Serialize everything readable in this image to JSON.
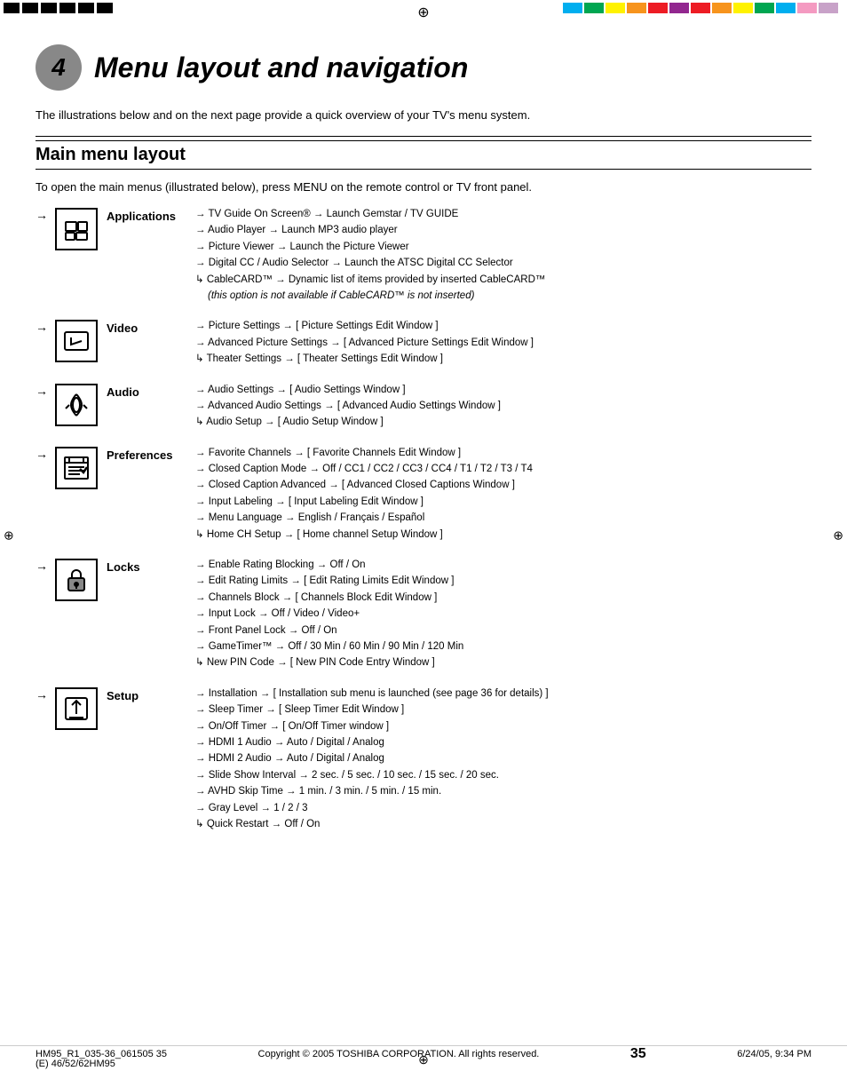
{
  "page": {
    "number": "35",
    "copyright": "Copyright © 2005 TOSHIBA CORPORATION. All rights reserved.",
    "footer_left": "HM95_R1_035-36_061505        35",
    "footer_right": "6/24/05, 9:34 PM",
    "bottom_model": "(E) 46/52/62HM95"
  },
  "chapter": {
    "number": "4",
    "title": "Menu layout and navigation"
  },
  "intro": "The illustrations below and on the next page provide a quick overview of your TV's menu system.",
  "section_title": "Main menu layout",
  "section_subtitle": "To open the main menus (illustrated below), press MENU on the remote control or TV front panel.",
  "menu_sections": [
    {
      "id": "applications",
      "label": "Applications",
      "items": [
        "TV Guide On Screen® → Launch Gemstar / TV GUIDE",
        "Audio Player → Launch MP3 audio player",
        "Picture Viewer → Launch the Picture Viewer",
        "Digital CC / Audio Selector → Launch the ATSC Digital CC Selector",
        "CableCARD™ → Dynamic list of items provided by inserted CableCARD™",
        "(this option is not available if CableCARD™ is not inserted)"
      ],
      "italic_index": 5
    },
    {
      "id": "video",
      "label": "Video",
      "items": [
        "Picture Settings → [ Picture Settings Edit Window ]",
        "Advanced Picture Settings → [ Advanced Picture Settings Edit Window ]",
        "Theater Settings → [ Theater Settings Edit Window ]"
      ]
    },
    {
      "id": "audio",
      "label": "Audio",
      "items": [
        "Audio Settings → [ Audio Settings Window ]",
        "Advanced Audio Settings → [ Advanced Audio Settings Window ]",
        "Audio Setup → [ Audio Setup Window ]"
      ]
    },
    {
      "id": "preferences",
      "label": "Preferences",
      "items": [
        "Favorite Channels → [ Favorite Channels Edit Window ]",
        "Closed Caption Mode → Off / CC1 / CC2 / CC3 / CC4 / T1 / T2 / T3 / T4",
        "Closed Caption Advanced → [ Advanced Closed Captions Window ]",
        "Input Labeling → [ Input Labeling Edit Window ]",
        "Menu Language → English / Français / Español",
        "Home CH Setup → [ Home channel Setup Window ]"
      ]
    },
    {
      "id": "locks",
      "label": "Locks",
      "items": [
        "Enable Rating Blocking → Off / On",
        "Edit Rating Limits → [ Edit Rating Limits Edit Window ]",
        "Channels Block → [ Channels Block Edit Window ]",
        "Input Lock → Off / Video / Video+",
        "Front Panel Lock → Off / On",
        "GameTimer™ → Off / 30 Min / 60 Min / 90 Min / 120 Min",
        "New PIN Code → [ New PIN Code Entry Window ]"
      ]
    },
    {
      "id": "setup",
      "label": "Setup",
      "items": [
        "Installation → [ Installation sub menu is launched (see page 36 for details) ]",
        "Sleep Timer → [ Sleep Timer Edit Window ]",
        "On/Off Timer → [ On/Off Timer window ]",
        "HDMI 1 Audio → Auto / Digital / Analog",
        "HDMI 2 Audio → Auto / Digital / Analog",
        "Slide Show Interval → 2 sec. / 5 sec. / 10 sec. / 15 sec. / 20 sec.",
        "AVHD Skip Time → 1 min. / 3 min. / 5 min. / 15 min.",
        "Gray Level → 1 / 2 / 3",
        "Quick Restart → Off / On"
      ]
    }
  ]
}
